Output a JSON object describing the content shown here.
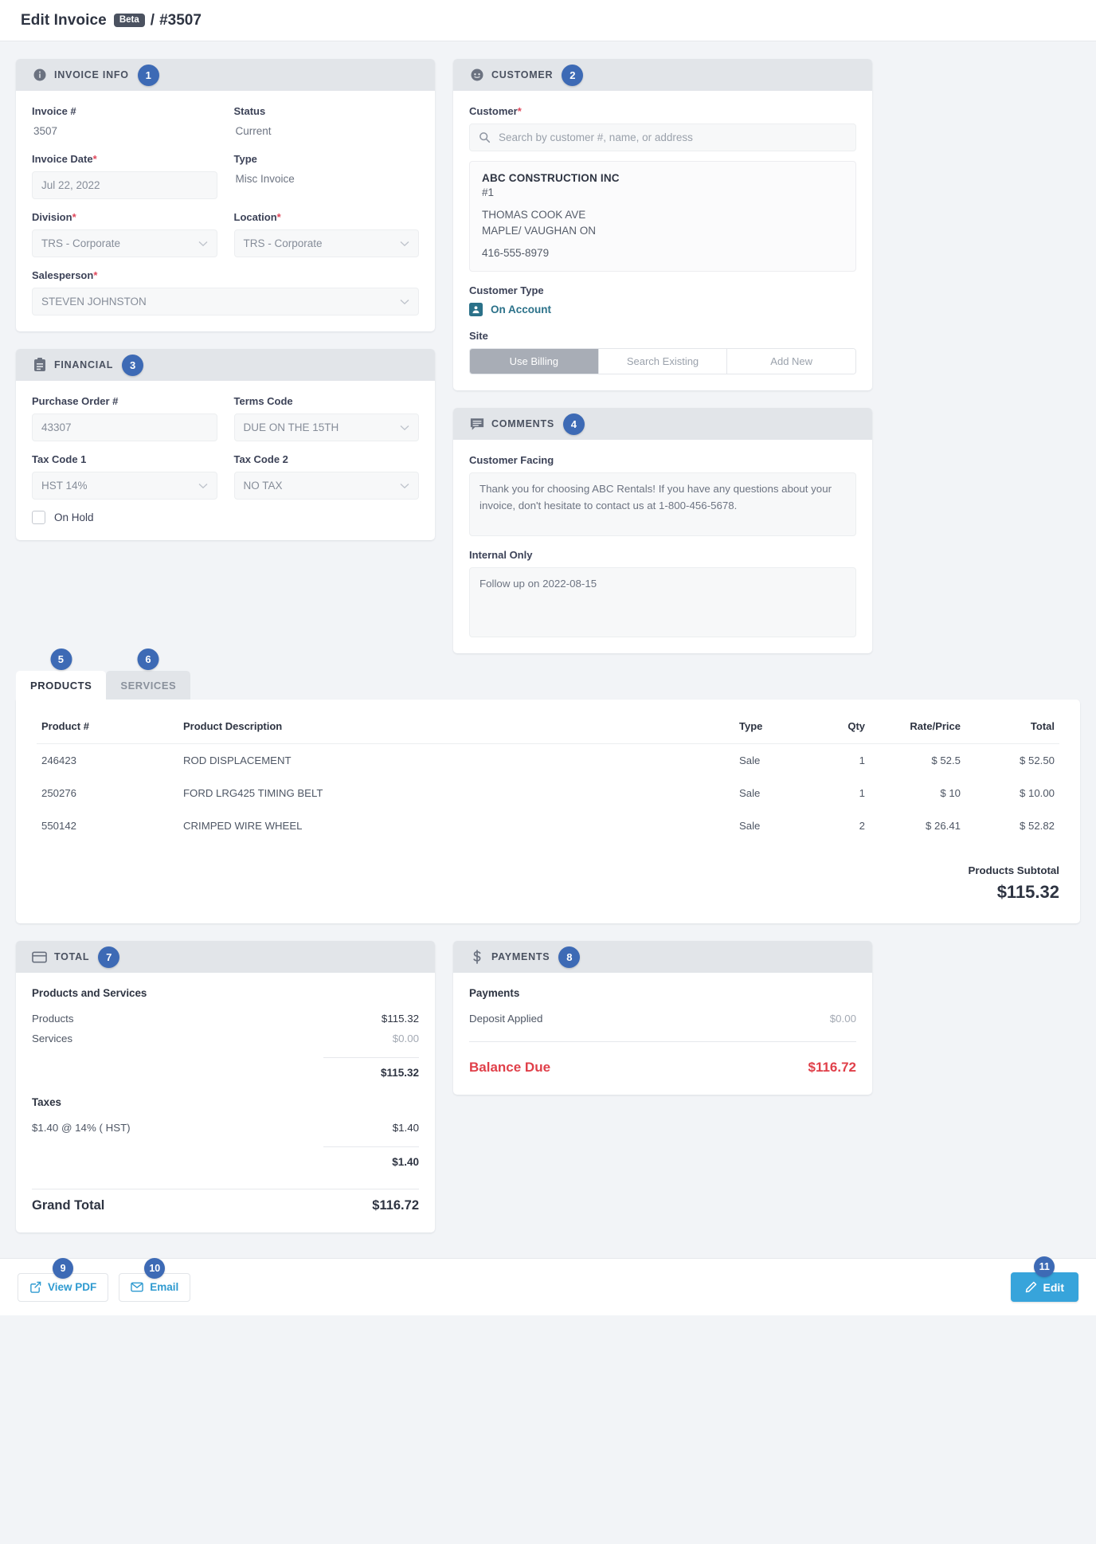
{
  "header": {
    "title": "Edit Invoice",
    "badge": "Beta",
    "separator": "/",
    "invoice_number": "#3507"
  },
  "invoice_info": {
    "heading": "INVOICE INFO",
    "step": "1",
    "invoice_number_label": "Invoice #",
    "invoice_number_value": "3507",
    "status_label": "Status",
    "status_value": "Current",
    "invoice_date_label": "Invoice Date",
    "invoice_date_value": "Jul 22, 2022",
    "type_label": "Type",
    "type_value": "Misc Invoice",
    "division_label": "Division",
    "division_value": "TRS - Corporate",
    "location_label": "Location",
    "location_value": "TRS - Corporate",
    "salesperson_label": "Salesperson",
    "salesperson_value": "STEVEN JOHNSTON"
  },
  "financial": {
    "heading": "FINANCIAL",
    "step": "3",
    "po_label": "Purchase Order #",
    "po_value": "43307",
    "terms_label": "Terms Code",
    "terms_value": "DUE ON THE 15TH",
    "tax1_label": "Tax Code 1",
    "tax1_value": "HST 14%",
    "tax2_label": "Tax Code 2",
    "tax2_value": "NO TAX",
    "on_hold_label": "On Hold",
    "on_hold_checked": false
  },
  "customer": {
    "heading": "CUSTOMER",
    "step": "2",
    "customer_label": "Customer",
    "search_placeholder": "Search by customer #, name, or address",
    "name": "ABC CONSTRUCTION INC",
    "number": "#1",
    "address_line1": "THOMAS COOK AVE",
    "address_line2": "MAPLE/ VAUGHAN ON",
    "phone": "416-555-8979",
    "customer_type_label": "Customer Type",
    "customer_type_value": "On Account",
    "site_label": "Site",
    "site_options": [
      "Use Billing",
      "Search Existing",
      "Add New"
    ],
    "site_selected": "Use Billing"
  },
  "comments": {
    "heading": "COMMENTS",
    "step": "4",
    "customer_facing_label": "Customer Facing",
    "customer_facing_value": "Thank you for choosing ABC Rentals! If you have any questions about your invoice, don't hesitate to contact us at 1-800-456-5678.",
    "internal_only_label": "Internal Only",
    "internal_only_value": "Follow up on 2022-08-15"
  },
  "line_items": {
    "tabs": [
      {
        "label": "PRODUCTS",
        "step": "5",
        "active": true
      },
      {
        "label": "SERVICES",
        "step": "6",
        "active": false
      }
    ],
    "columns": [
      "Product #",
      "Product Description",
      "Type",
      "Qty",
      "Rate/Price",
      "Total"
    ],
    "rows": [
      {
        "product": "246423",
        "description": "ROD DISPLACEMENT",
        "type": "Sale",
        "qty": "1",
        "rate": "$ 52.5",
        "total": "$ 52.50"
      },
      {
        "product": "250276",
        "description": "FORD LRG425 TIMING BELT",
        "type": "Sale",
        "qty": "1",
        "rate": "$ 10",
        "total": "$ 10.00"
      },
      {
        "product": "550142",
        "description": "CRIMPED WIRE WHEEL",
        "type": "Sale",
        "qty": "2",
        "rate": "$ 26.41",
        "total": "$ 52.82"
      }
    ],
    "subtotal_label": "Products Subtotal",
    "subtotal_value": "$115.32"
  },
  "total": {
    "heading": "TOTAL",
    "step": "7",
    "section_label": "Products and Services",
    "products_label": "Products",
    "products_value": "$115.32",
    "services_label": "Services",
    "services_value": "$0.00",
    "products_services_sum": "$115.32",
    "taxes_label": "Taxes",
    "tax_line_label": "$1.40 @ 14% ( HST)",
    "tax_line_value": "$1.40",
    "taxes_sum": "$1.40",
    "grand_total_label": "Grand Total",
    "grand_total_value": "$116.72"
  },
  "payments": {
    "heading": "PAYMENTS",
    "step": "8",
    "section_label": "Payments",
    "deposit_label": "Deposit Applied",
    "deposit_value": "$0.00",
    "balance_label": "Balance Due",
    "balance_value": "$116.72"
  },
  "actions": {
    "view_pdf": "View PDF",
    "view_pdf_step": "9",
    "email": "Email",
    "email_step": "10",
    "edit": "Edit",
    "edit_step": "11"
  },
  "colors": {
    "step_badge": "#3d6ab5",
    "primary": "#37a4db",
    "danger": "#e0404a",
    "link": "#2b7189",
    "required": "#e0475b"
  }
}
